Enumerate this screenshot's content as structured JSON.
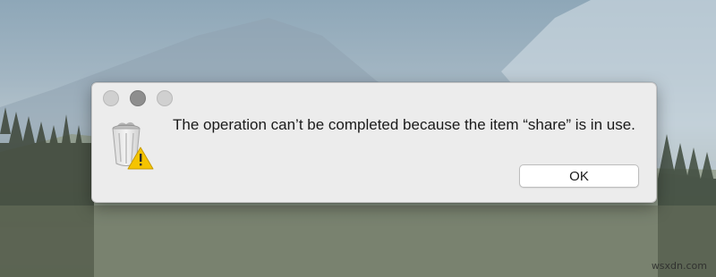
{
  "dialog": {
    "message": "The operation can’t be completed because the item “share” is in use.",
    "ok_label": "OK",
    "icon": "trash-warning-icon"
  },
  "window_controls": [
    "close-button",
    "minimize-button",
    "zoom-button"
  ],
  "watermark": "wsxdn.com",
  "colors": {
    "dialog_background": "#ececec",
    "warning_yellow": "#f5c400"
  }
}
